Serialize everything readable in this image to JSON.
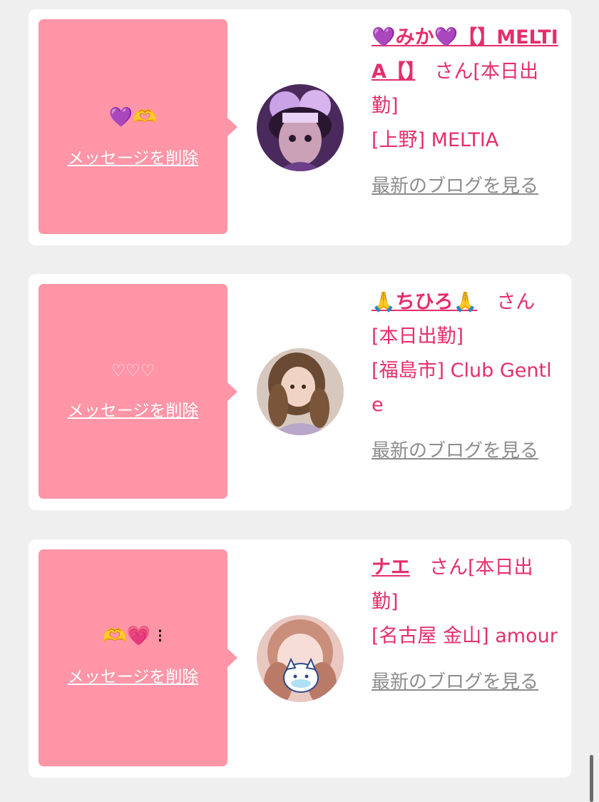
{
  "colors": {
    "bubble": "#ff95a7",
    "accent_pink": "#e52e6b",
    "blog_link_gray": "#8c8c8c",
    "page_background": "#efefef"
  },
  "entries": [
    {
      "message": "💜🫶",
      "delete_label": "メッセージを削除",
      "avatar_icon": "avatar-purple-costume-girl",
      "name": "💜みか💜【】MELTIA【】",
      "suffix": "さん[本日出勤]",
      "location": "[上野] MELTIA",
      "blog_label": "最新のブログを見る"
    },
    {
      "message": "♡♡♡",
      "delete_label": "メッセージを削除",
      "avatar_icon": "avatar-brown-haired-girl",
      "name": "🙏ちひろ🙏",
      "suffix": "さん[本日出勤]",
      "location": "[福島市] Club Gentle",
      "blog_label": "最新のブログを見る"
    },
    {
      "message": "🫶💗 ⁝",
      "delete_label": "メッセージを削除",
      "avatar_icon": "avatar-girl-with-cat-sticker",
      "name": "ナエ",
      "suffix": "さん[本日出勤]",
      "location": "[名古屋 金山] amour",
      "blog_label": "最新のブログを見る"
    }
  ]
}
